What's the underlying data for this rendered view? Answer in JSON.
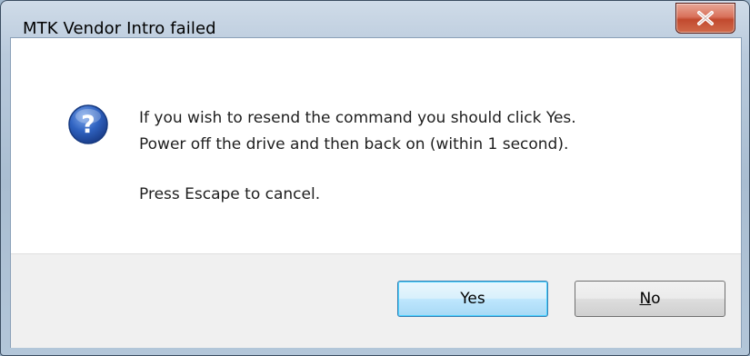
{
  "window": {
    "title": "MTK Vendor Intro failed",
    "close_icon": "close-icon"
  },
  "dialog": {
    "icon": "question-icon",
    "icon_glyph": "?",
    "message_line_1": "If you wish to resend the command you should click Yes.",
    "message_line_2": "Power off the drive and then back on (within 1 second).",
    "message_line_3": "Press Escape to cancel."
  },
  "buttons": {
    "yes_label": "Yes",
    "no_mnemonic": "N",
    "no_rest": "o"
  },
  "colors": {
    "close_button": "#c8533a",
    "default_button_border": "#3c7fb1",
    "question_icon": "#2b5fb4"
  }
}
